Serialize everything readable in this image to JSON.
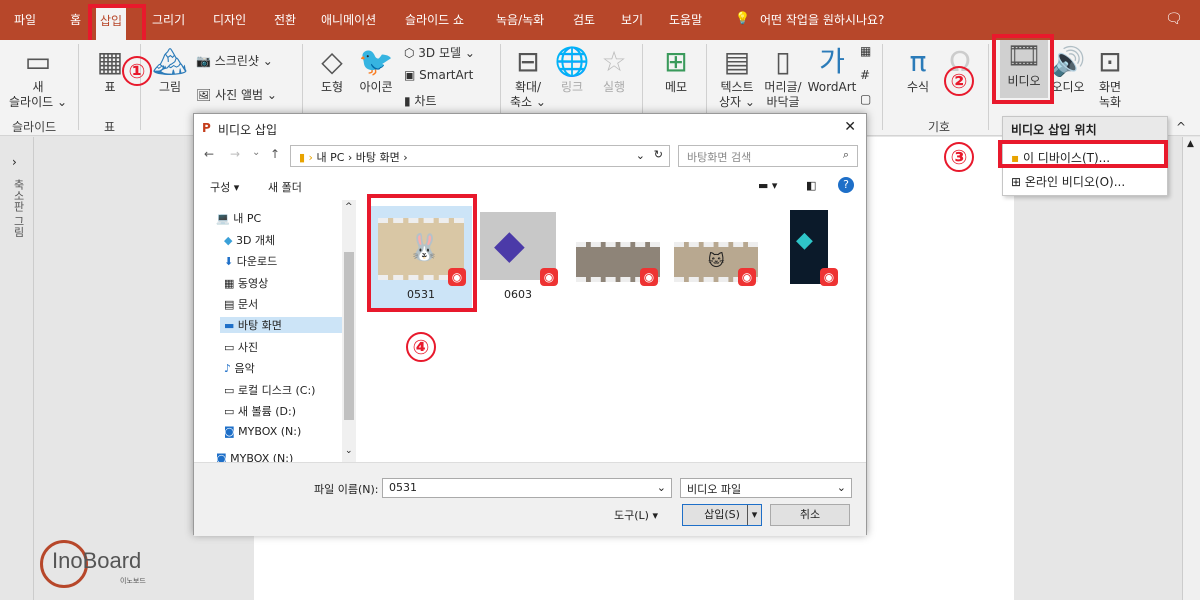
{
  "tabs": [
    "파일",
    "홈",
    "삽입",
    "그리기",
    "디자인",
    "전환",
    "애니메이션",
    "슬라이드 쇼",
    "녹음/녹화",
    "검토",
    "보기",
    "도움말"
  ],
  "tell_me": "어떤 작업을 원하시나요?",
  "ribbon": {
    "new_slide": "새",
    "new_slide2": "슬라이드 ⌄",
    "table": "표",
    "picture": "그림",
    "screenshot": "스크린샷 ⌄",
    "photo_album": "사진 앨범 ⌄",
    "shapes": "도형",
    "icons": "아이콘",
    "model3d": "3D 모델 ⌄",
    "smartart": "SmartArt",
    "chart": "차트",
    "zoom": "확대/",
    "zoom2": "축소 ⌄",
    "link": "링크",
    "action": "실행",
    "comment": "메모",
    "textbox": "텍스트",
    "textbox2": "상자 ⌄",
    "headerfooter": "머리글/",
    "headerfooter2": "바닥글",
    "wordart": "WordArt",
    "equation": "수식",
    "video": "비디오",
    "audio": "오디오",
    "screenrec": "화면",
    "screenrec2": "녹화",
    "g_slides": "슬라이드",
    "g_tables": "표",
    "g_symbols": "기호"
  },
  "dropdown": {
    "title": "비디오 삽입 위치",
    "this_device": "이 디바이스(T)...",
    "online": "온라인 비디오(O)..."
  },
  "leftpane": "축소판 그림",
  "dialog": {
    "title": "비디오 삽입",
    "path": [
      "내 PC",
      "바탕 화면"
    ],
    "search": "바탕화면 검색",
    "organize": "구성 ▾",
    "new_folder": "새 폴더",
    "tree": [
      "내 PC",
      "3D 개체",
      "다운로드",
      "동영상",
      "문서",
      "바탕 화면",
      "사진",
      "음악",
      "로컬 디스크 (C:)",
      "새 볼륨 (D:)",
      "MYBOX (N:)",
      "MYBOX (N:)"
    ],
    "files": [
      {
        "name": "0531"
      },
      {
        "name": "0603"
      },
      {
        "name": ""
      },
      {
        "name": ""
      },
      {
        "name": ""
      }
    ],
    "filename_label": "파일 이름(N):",
    "filename": "0531",
    "filetype": "비디오 파일",
    "tools": "도구(L) ▾",
    "insert": "삽입(S)",
    "cancel": "취소"
  },
  "markers": [
    "①",
    "②",
    "③",
    "④"
  ],
  "logo": {
    "text": "InoBoard",
    "sub": "이노보드"
  },
  "colors": {
    "accent": "#b7472a",
    "highlight": "#e8192c",
    "selection": "#cce4f7"
  }
}
